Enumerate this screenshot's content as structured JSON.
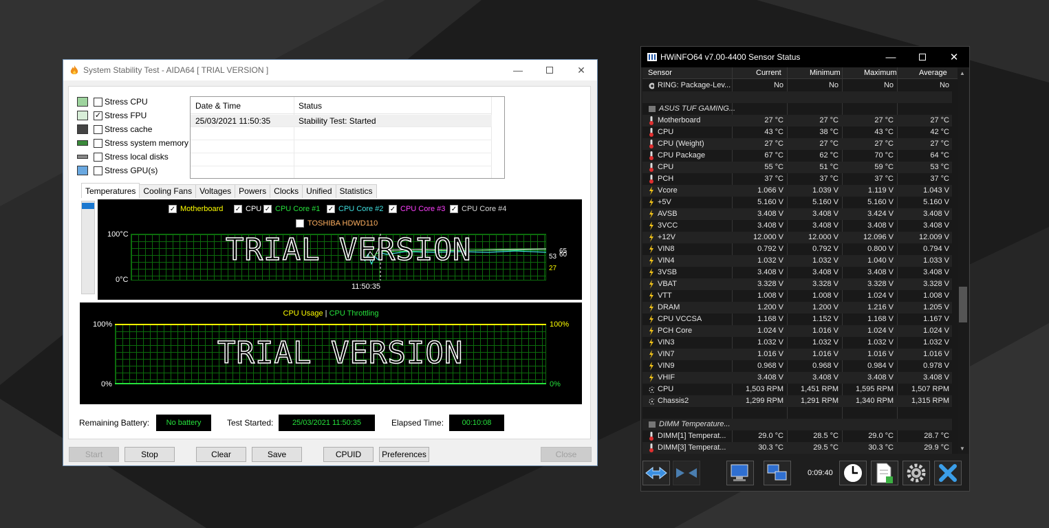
{
  "aida": {
    "title": "System Stability Test - AIDA64  [ TRIAL VERSION ]",
    "stress": [
      {
        "label": "Stress CPU",
        "checked": false,
        "icon": "cpu-chip-icon"
      },
      {
        "label": "Stress FPU",
        "checked": true,
        "icon": "fpu-icon"
      },
      {
        "label": "Stress cache",
        "checked": false,
        "icon": "cache-icon"
      },
      {
        "label": "Stress system memory",
        "checked": false,
        "icon": "memory-icon"
      },
      {
        "label": "Stress local disks",
        "checked": false,
        "icon": "disk-icon"
      },
      {
        "label": "Stress GPU(s)",
        "checked": false,
        "icon": "gpu-icon"
      }
    ],
    "log": {
      "headers": [
        "Date & Time",
        "Status"
      ],
      "rows": [
        {
          "time": "25/03/2021 11:50:35",
          "status": "Stability Test: Started"
        }
      ]
    },
    "tabs": [
      "Temperatures",
      "Cooling Fans",
      "Voltages",
      "Powers",
      "Clocks",
      "Unified",
      "Statistics"
    ],
    "temp_graph": {
      "legend": [
        {
          "label": "Motherboard",
          "color": "#ffff00"
        },
        {
          "label": "CPU",
          "color": "#ffffff"
        },
        {
          "label": "CPU Core #1",
          "color": "#26e23c"
        },
        {
          "label": "CPU Core #2",
          "color": "#40e0e0"
        },
        {
          "label": "CPU Core #3",
          "color": "#ff40ff"
        },
        {
          "label": "CPU Core #4",
          "color": "#d8d8d8"
        }
      ],
      "legend2": {
        "label": "TOSHIBA HDWD110",
        "color": "#ffb060"
      },
      "ymax": "100°C",
      "ymin": "0°C",
      "time": "11:50:35",
      "watermark": "TRIAL VERSION",
      "end_values": [
        "65",
        "60",
        "53",
        "27"
      ]
    },
    "usage_graph": {
      "title1": "CPU Usage",
      "sep": "|",
      "title2": "CPU Throttling",
      "ymax_left": "100%",
      "ymin_left": "0%",
      "ymax_right": "100%",
      "ymin_right": "0%",
      "watermark": "TRIAL VERSION"
    },
    "status": {
      "battery_label": "Remaining Battery:",
      "battery_value": "No battery",
      "started_label": "Test Started:",
      "started_value": "25/03/2021 11:50:35",
      "elapsed_label": "Elapsed Time:",
      "elapsed_value": "00:10:08"
    },
    "buttons": {
      "start": "Start",
      "stop": "Stop",
      "clear": "Clear",
      "save": "Save",
      "cpuid": "CPUID",
      "preferences": "Preferences",
      "close": "Close"
    }
  },
  "hwinfo": {
    "title": "HWiNFO64 v7.00-4400 Sensor Status",
    "columns": [
      "Sensor",
      "Current",
      "Minimum",
      "Maximum",
      "Average"
    ],
    "rows": [
      {
        "type": "data",
        "icon": "circle",
        "name": "RING: Package-Lev...",
        "cur": "No",
        "min": "No",
        "max": "No",
        "avg": "No"
      },
      {
        "type": "blank"
      },
      {
        "type": "group",
        "name": "ASUS TUF GAMING..."
      },
      {
        "type": "data",
        "icon": "temp",
        "name": "Motherboard",
        "cur": "27 °C",
        "min": "27 °C",
        "max": "27 °C",
        "avg": "27 °C"
      },
      {
        "type": "data",
        "icon": "temp",
        "name": "CPU",
        "cur": "43 °C",
        "min": "38 °C",
        "max": "43 °C",
        "avg": "42 °C"
      },
      {
        "type": "data",
        "icon": "temp",
        "name": "CPU (Weight)",
        "cur": "27 °C",
        "min": "27 °C",
        "max": "27 °C",
        "avg": "27 °C"
      },
      {
        "type": "data",
        "icon": "temp",
        "name": "CPU Package",
        "cur": "67 °C",
        "min": "62 °C",
        "max": "70 °C",
        "avg": "64 °C"
      },
      {
        "type": "data",
        "icon": "temp",
        "name": "CPU",
        "cur": "55 °C",
        "min": "51 °C",
        "max": "59 °C",
        "avg": "53 °C"
      },
      {
        "type": "data",
        "icon": "temp",
        "name": "PCH",
        "cur": "37 °C",
        "min": "37 °C",
        "max": "37 °C",
        "avg": "37 °C"
      },
      {
        "type": "data",
        "icon": "volt",
        "name": "Vcore",
        "cur": "1.066 V",
        "min": "1.039 V",
        "max": "1.119 V",
        "avg": "1.043 V"
      },
      {
        "type": "data",
        "icon": "volt",
        "name": "+5V",
        "cur": "5.160 V",
        "min": "5.160 V",
        "max": "5.160 V",
        "avg": "5.160 V"
      },
      {
        "type": "data",
        "icon": "volt",
        "name": "AVSB",
        "cur": "3.408 V",
        "min": "3.408 V",
        "max": "3.424 V",
        "avg": "3.408 V"
      },
      {
        "type": "data",
        "icon": "volt",
        "name": "3VCC",
        "cur": "3.408 V",
        "min": "3.408 V",
        "max": "3.408 V",
        "avg": "3.408 V"
      },
      {
        "type": "data",
        "icon": "volt",
        "name": "+12V",
        "cur": "12.000 V",
        "min": "12.000 V",
        "max": "12.096 V",
        "avg": "12.009 V"
      },
      {
        "type": "data",
        "icon": "volt",
        "name": "VIN8",
        "cur": "0.792 V",
        "min": "0.792 V",
        "max": "0.800 V",
        "avg": "0.794 V"
      },
      {
        "type": "data",
        "icon": "volt",
        "name": "VIN4",
        "cur": "1.032 V",
        "min": "1.032 V",
        "max": "1.040 V",
        "avg": "1.033 V"
      },
      {
        "type": "data",
        "icon": "volt",
        "name": "3VSB",
        "cur": "3.408 V",
        "min": "3.408 V",
        "max": "3.408 V",
        "avg": "3.408 V"
      },
      {
        "type": "data",
        "icon": "volt",
        "name": "VBAT",
        "cur": "3.328 V",
        "min": "3.328 V",
        "max": "3.328 V",
        "avg": "3.328 V"
      },
      {
        "type": "data",
        "icon": "volt",
        "name": "VTT",
        "cur": "1.008 V",
        "min": "1.008 V",
        "max": "1.024 V",
        "avg": "1.008 V"
      },
      {
        "type": "data",
        "icon": "volt",
        "name": "DRAM",
        "cur": "1.200 V",
        "min": "1.200 V",
        "max": "1.216 V",
        "avg": "1.205 V"
      },
      {
        "type": "data",
        "icon": "volt",
        "name": "CPU VCCSA",
        "cur": "1.168 V",
        "min": "1.152 V",
        "max": "1.168 V",
        "avg": "1.167 V"
      },
      {
        "type": "data",
        "icon": "volt",
        "name": "PCH Core",
        "cur": "1.024 V",
        "min": "1.016 V",
        "max": "1.024 V",
        "avg": "1.024 V"
      },
      {
        "type": "data",
        "icon": "volt",
        "name": "VIN3",
        "cur": "1.032 V",
        "min": "1.032 V",
        "max": "1.032 V",
        "avg": "1.032 V"
      },
      {
        "type": "data",
        "icon": "volt",
        "name": "VIN7",
        "cur": "1.016 V",
        "min": "1.016 V",
        "max": "1.016 V",
        "avg": "1.016 V"
      },
      {
        "type": "data",
        "icon": "volt",
        "name": "VIN9",
        "cur": "0.968 V",
        "min": "0.968 V",
        "max": "0.984 V",
        "avg": "0.978 V"
      },
      {
        "type": "data",
        "icon": "volt",
        "name": "VHIF",
        "cur": "3.408 V",
        "min": "3.408 V",
        "max": "3.408 V",
        "avg": "3.408 V"
      },
      {
        "type": "data",
        "icon": "fan",
        "name": "CPU",
        "cur": "1,503 RPM",
        "min": "1,451 RPM",
        "max": "1,595 RPM",
        "avg": "1,507 RPM"
      },
      {
        "type": "data",
        "icon": "fan",
        "name": "Chassis2",
        "cur": "1,299 RPM",
        "min": "1,291 RPM",
        "max": "1,340 RPM",
        "avg": "1,315 RPM"
      },
      {
        "type": "blank"
      },
      {
        "type": "group",
        "name": "DIMM Temperature..."
      },
      {
        "type": "data",
        "icon": "temp",
        "name": "DIMM[1] Temperat...",
        "cur": "29.0 °C",
        "min": "28.5 °C",
        "max": "29.0 °C",
        "avg": "28.7 °C"
      },
      {
        "type": "data",
        "icon": "temp",
        "name": "DIMM[3] Temperat...",
        "cur": "30.3 °C",
        "min": "29.5 °C",
        "max": "30.3 °C",
        "avg": "29.9 °C"
      }
    ],
    "timer": "0:09:40",
    "toolbar_icons": [
      "nav-left-right-icon",
      "nav-collapse-icon",
      "monitor-icon",
      "network-icon",
      "clock-icon",
      "report-icon",
      "settings-icon",
      "close-x-icon"
    ]
  }
}
